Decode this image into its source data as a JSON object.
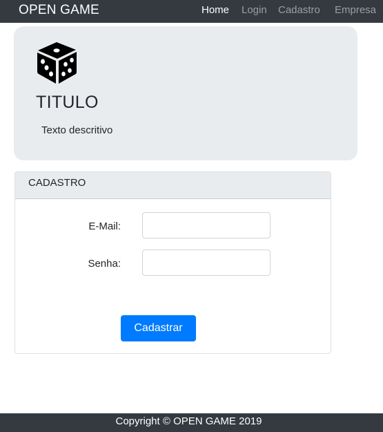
{
  "navbar": {
    "brand": "OPEN GAME",
    "items": [
      {
        "label": "Home",
        "active": true
      },
      {
        "label": "Login",
        "active": false
      },
      {
        "label": "Cadastro",
        "active": false
      },
      {
        "label": "Empresa",
        "active": false
      }
    ]
  },
  "jumbotron": {
    "icon": "dice-icon",
    "title": "TITULO",
    "description": "Texto descritivo"
  },
  "form": {
    "header": "CADASTRO",
    "email_label": "E-Mail:",
    "email_value": "",
    "senha_label": "Senha:",
    "senha_value": "",
    "submit_label": "Cadastrar"
  },
  "footer": {
    "text": "Copyright © OPEN GAME 2019"
  },
  "colors": {
    "navbar_bg": "#343a40",
    "jumbotron_bg": "#e9ecef",
    "primary": "#007bff"
  }
}
